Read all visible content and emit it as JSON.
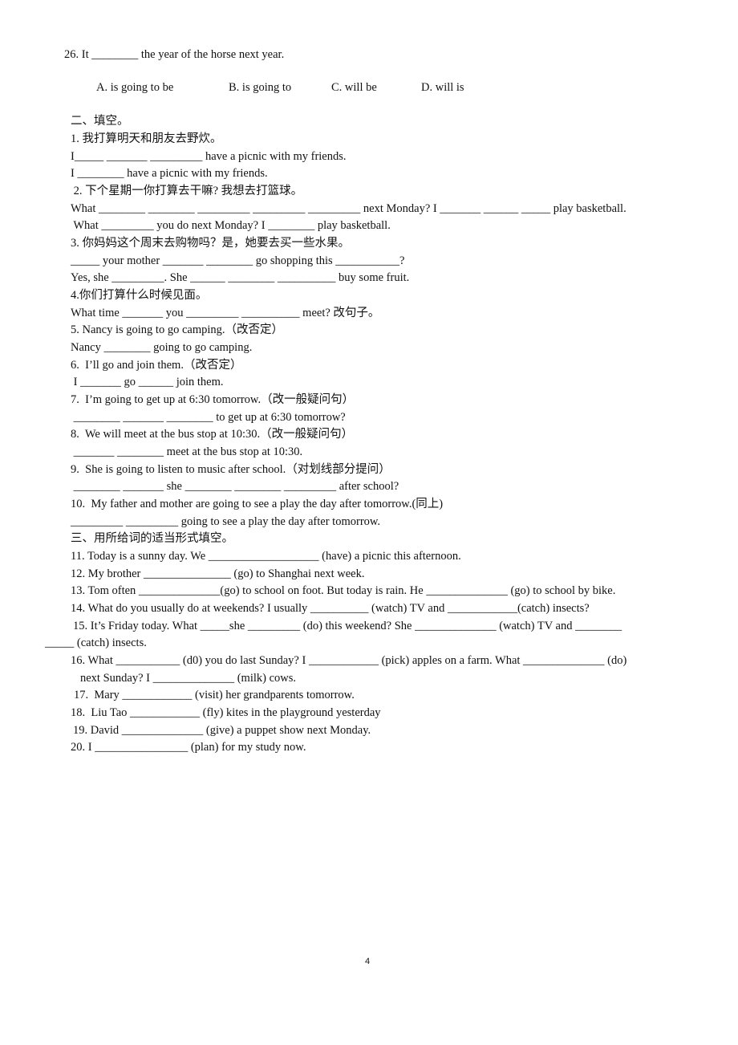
{
  "q26": {
    "stem": "26. It ________ the year of the horse next year.",
    "options": [
      "A. is going to be",
      "B. is going to",
      "C. will be",
      "D. will is"
    ]
  },
  "section2": {
    "heading": "二、填空。",
    "lines": [
      "1. 我打算明天和朋友去野炊。",
      "I_____ _______ _________ have a picnic with my friends.",
      "I ________ have a picnic with my friends.",
      " 2. 下个星期一你打算去干嘛? 我想去打篮球。",
      "What ________ ________ _________ _________ _________ next Monday? I _______ ______ _____ play basketball.",
      " What _________ you do next Monday? I ________ play basketball.",
      "3. 你妈妈这个周末去购物吗？是，她要去买一些水果。",
      "_____ your mother _______ ________ go shopping this ___________?",
      "Yes, she _________. She ______ ________ __________ buy some fruit.",
      "4.你们打算什么时候见面。",
      "What time _______ you _________ __________ meet? 改句子。",
      "5. Nancy is going to go camping.（改否定）",
      "Nancy ________ going to go camping.",
      "6.  I’ll go and join them.（改否定）",
      " I _______ go ______ join them.",
      "7.  I’m going to get up at 6:30 tomorrow.（改一般疑问句）",
      " ________ _______ ________ to get up at 6:30 tomorrow?",
      "8.  We will meet at the bus stop at 10:30.（改一般疑问句）",
      " _______ ________ meet at the bus stop at 10:30.",
      "9.  She is going to listen to music after school.（对划线部分提问）",
      " ________ _______ she ________ ________ _________ after school?",
      "10.  My father and mother are going to see a play the day after tomorrow.(同上)",
      "_________ _________ going to see a play the day after tomorrow."
    ]
  },
  "section3": {
    "heading": "三、用所给词的适当形式填空。",
    "lines": [
      "11. Today is a sunny day. We ___________________ (have) a picnic this afternoon.",
      "12. My brother _______________ (go) to Shanghai next week.",
      "13. Tom often ______________(go) to school on foot. But today is rain. He ______________ (go) to school by bike.",
      "14. What do you usually do at weekends? I usually __________ (watch) TV and ____________(catch) insects?",
      "15. It’s Friday today. What _____she _________ (do) this weekend? She ______________ (watch) TV and ________",
      "_____ (catch) insects.",
      "16. What ___________ (d0) you do last Sunday? I ____________ (pick) apples on a farm. What ______________ (do)",
      "next Sunday? I ______________ (milk) cows.",
      "17.  Mary ____________ (visit) her grandparents tomorrow.",
      "18.  Liu Tao ____________ (fly) kites in the playground yesterday",
      "19. David ______________ (give) a puppet show next Monday.",
      "20. I ________________ (plan) for my study now."
    ]
  },
  "footer": {
    "page_number": "4"
  }
}
